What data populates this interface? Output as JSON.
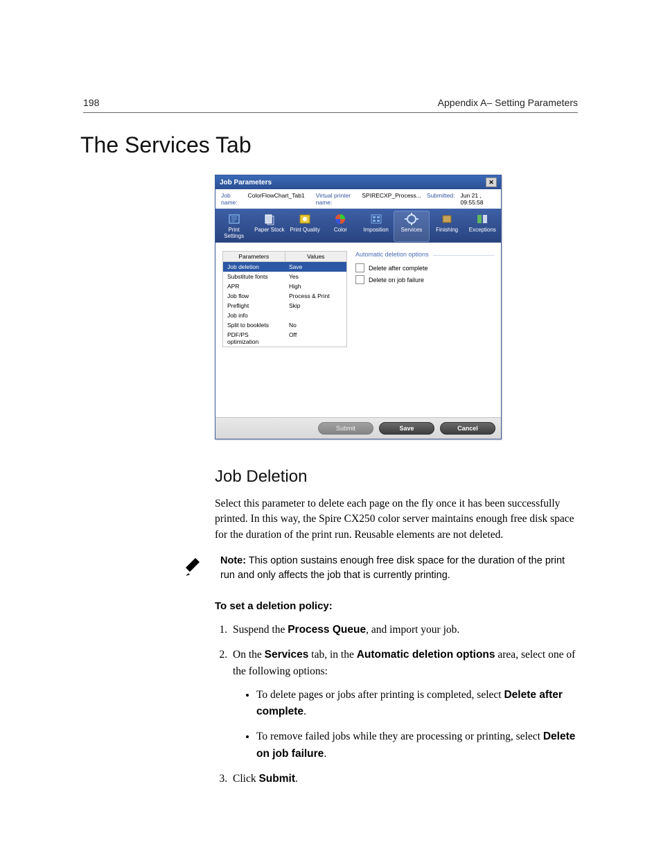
{
  "header": {
    "page_number": "198",
    "chapter": "Appendix A– Setting Parameters"
  },
  "title": "The Services Tab",
  "dialog": {
    "title": "Job Parameters",
    "info": {
      "job_name_lbl": "Job name:",
      "job_name": "ColorFlowChart_Tab1",
      "vp_lbl": "Virtual printer name:",
      "vp": "SPIRECXP_Process...",
      "sub_lbl": "Submitted:",
      "sub": "Jun 21 , 09:55:58"
    },
    "tabs": [
      {
        "label": "Print Settings"
      },
      {
        "label": "Paper Stock"
      },
      {
        "label": "Print Quality"
      },
      {
        "label": "Color"
      },
      {
        "label": "Imposition"
      },
      {
        "label": "Services"
      },
      {
        "label": "Finishing"
      },
      {
        "label": "Exceptions"
      }
    ],
    "params_header": {
      "c1": "Parameters",
      "c2": "Values"
    },
    "params": [
      {
        "p": "Job deletion",
        "v": "Save",
        "sel": true
      },
      {
        "p": "Substitute fonts",
        "v": "Yes"
      },
      {
        "p": "APR",
        "v": "High"
      },
      {
        "p": "Job flow",
        "v": "Process & Print"
      },
      {
        "p": "Preflight",
        "v": "Skip"
      },
      {
        "p": "Job info",
        "v": ""
      },
      {
        "p": "Split to booklets",
        "v": "No"
      },
      {
        "p": "PDF/PS optimization",
        "v": "Off"
      }
    ],
    "fieldset_title": "Automatic deletion options",
    "chk1": "Delete after complete",
    "chk2": "Delete on job failure",
    "btn_submit": "Submit",
    "btn_save": "Save",
    "btn_cancel": "Cancel"
  },
  "section": {
    "heading": "Job Deletion",
    "para": "Select this parameter to delete each page on the fly once it has been successfully printed. In this way, the Spire CX250 color server maintains enough free disk space for the duration of the print run. Reusable elements are not deleted."
  },
  "note": {
    "prefix": "Note:",
    "text": "  This option sustains enough free disk space for the duration of the print run and only affects the job that is currently printing."
  },
  "procedure": {
    "title": "To set a deletion policy:",
    "s1_a": "Suspend the ",
    "s1_b": "Process Queue",
    "s1_c": ", and import your job.",
    "s2_a": "On the ",
    "s2_b": "Services",
    "s2_c": " tab, in the ",
    "s2_d": "Automatic deletion options",
    "s2_e": " area, select one of the following options:",
    "b1_a": "To delete pages or jobs after printing is completed, select ",
    "b1_b": "Delete after complete",
    "b1_c": ".",
    "b2_a": "To remove failed jobs while they are processing or printing, select ",
    "b2_b": "Delete on job failure",
    "b2_c": ".",
    "s3_a": "Click ",
    "s3_b": "Submit",
    "s3_c": "."
  }
}
